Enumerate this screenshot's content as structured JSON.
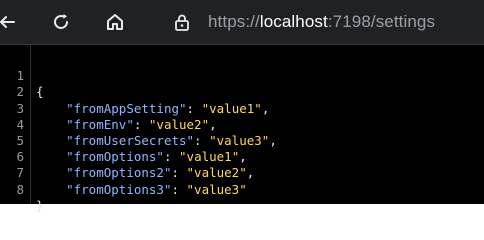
{
  "browser": {
    "url": {
      "scheme": "https://",
      "host": "localhost",
      "path": ":7198/settings"
    },
    "icons": [
      "back-arrow-icon",
      "reload-icon",
      "home-icon",
      "lock-icon"
    ]
  },
  "json_view": {
    "lines": [
      {
        "n": "1",
        "text": "{"
      },
      {
        "n": "2",
        "key": "\"fromAppSetting\"",
        "sep": ": ",
        "value": "\"value1\"",
        "end": ","
      },
      {
        "n": "3",
        "key": "\"fromEnv\"",
        "sep": ": ",
        "value": "\"value2\"",
        "end": ","
      },
      {
        "n": "4",
        "key": "\"fromUserSecrets\"",
        "sep": ": ",
        "value": "\"value3\"",
        "end": ","
      },
      {
        "n": "5",
        "key": "\"fromOptions\"",
        "sep": ": ",
        "value": "\"value1\"",
        "end": ","
      },
      {
        "n": "6",
        "key": "\"fromOptions2\"",
        "sep": ": ",
        "value": "\"value2\"",
        "end": ","
      },
      {
        "n": "7",
        "key": "\"fromOptions3\"",
        "sep": ": ",
        "value": "\"value3\"",
        "end": ""
      },
      {
        "n": "8",
        "text": "}"
      }
    ]
  },
  "colors": {
    "toolbar": "#202124",
    "code_background": "#000000",
    "key": "#8fb5ff",
    "string": "#ffd75f"
  }
}
